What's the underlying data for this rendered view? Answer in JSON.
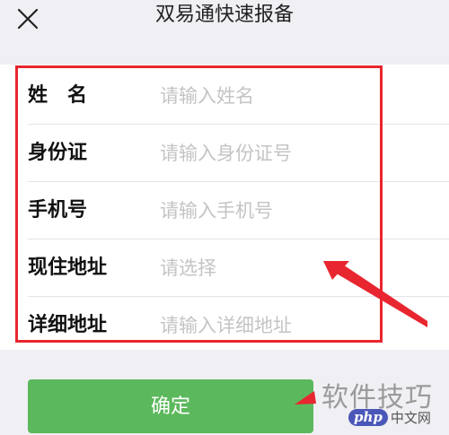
{
  "header": {
    "title": "双易通快速报备",
    "close_icon": "close-icon"
  },
  "form": {
    "rows": [
      {
        "label": "姓　名",
        "placeholder": "请输入姓名"
      },
      {
        "label": "身份证",
        "placeholder": "请输入身份证号"
      },
      {
        "label": "手机号",
        "placeholder": "请输入手机号"
      },
      {
        "label": "现住地址",
        "placeholder": "请选择"
      },
      {
        "label": "详细地址",
        "placeholder": "请输入详细地址"
      }
    ]
  },
  "confirm_label": "确定",
  "watermark": {
    "text": "软件技巧",
    "brand_logo": "php",
    "brand_site": "中文网"
  },
  "colors": {
    "annotation": "#e8262f",
    "confirm_button": "#5cb85c",
    "brand": "#4b57b8"
  }
}
